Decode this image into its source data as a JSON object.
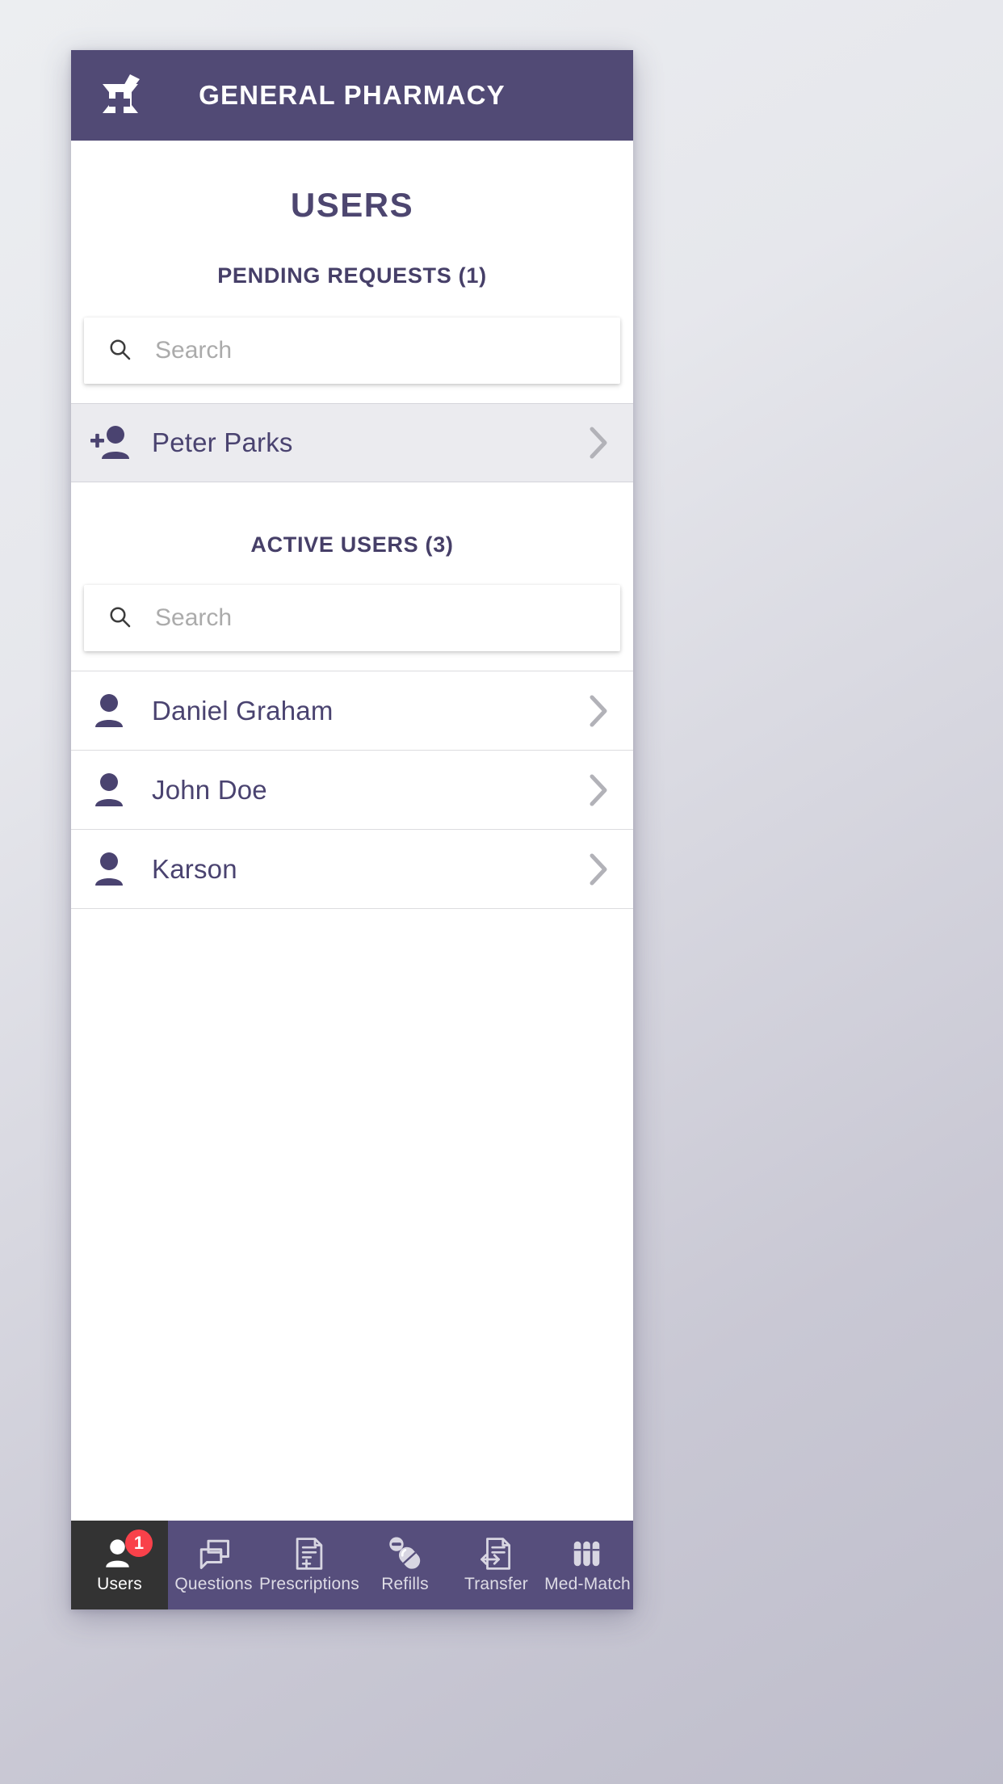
{
  "header": {
    "title": "GENERAL PHARMACY",
    "logo_icon": "mortar-and-pestle-icon",
    "background_color": "#514a75"
  },
  "main": {
    "page_title": "USERS",
    "pending": {
      "heading": "PENDING REQUESTS (1)",
      "search_placeholder": "Search",
      "search_value": "",
      "search_icon": "search-icon",
      "users": [
        {
          "name": "Peter Parks",
          "icon": "person-add-icon",
          "chevron": "chevron-right-icon"
        }
      ]
    },
    "active": {
      "heading": "ACTIVE USERS (3)",
      "search_placeholder": "Search",
      "search_value": "",
      "search_icon": "search-icon",
      "users": [
        {
          "name": "Daniel Graham",
          "icon": "person-icon",
          "chevron": "chevron-right-icon"
        },
        {
          "name": "John Doe",
          "icon": "person-icon",
          "chevron": "chevron-right-icon"
        },
        {
          "name": "Karson",
          "icon": "person-icon",
          "chevron": "chevron-right-icon"
        }
      ]
    }
  },
  "bottom_nav": {
    "background_color": "#564e7c",
    "active_background_color": "#333333",
    "badge_color": "#f9414a",
    "items": [
      {
        "label": "Users",
        "icon": "person-icon",
        "badge": "1",
        "active": true
      },
      {
        "label": "Questions",
        "icon": "chat-bubbles-icon",
        "badge": null,
        "active": false
      },
      {
        "label": "Prescriptions",
        "icon": "document-plus-icon",
        "badge": null,
        "active": false
      },
      {
        "label": "Refills",
        "icon": "pills-icon",
        "badge": null,
        "active": false
      },
      {
        "label": "Transfer",
        "icon": "document-transfer-icon",
        "badge": null,
        "active": false
      },
      {
        "label": "Med-Match",
        "icon": "capsules-icon",
        "badge": null,
        "active": false
      }
    ]
  },
  "colors": {
    "brand_purple": "#514a75",
    "text_purple": "#4a4370",
    "row_highlight": "#ebebef",
    "badge_red": "#f9414a"
  }
}
